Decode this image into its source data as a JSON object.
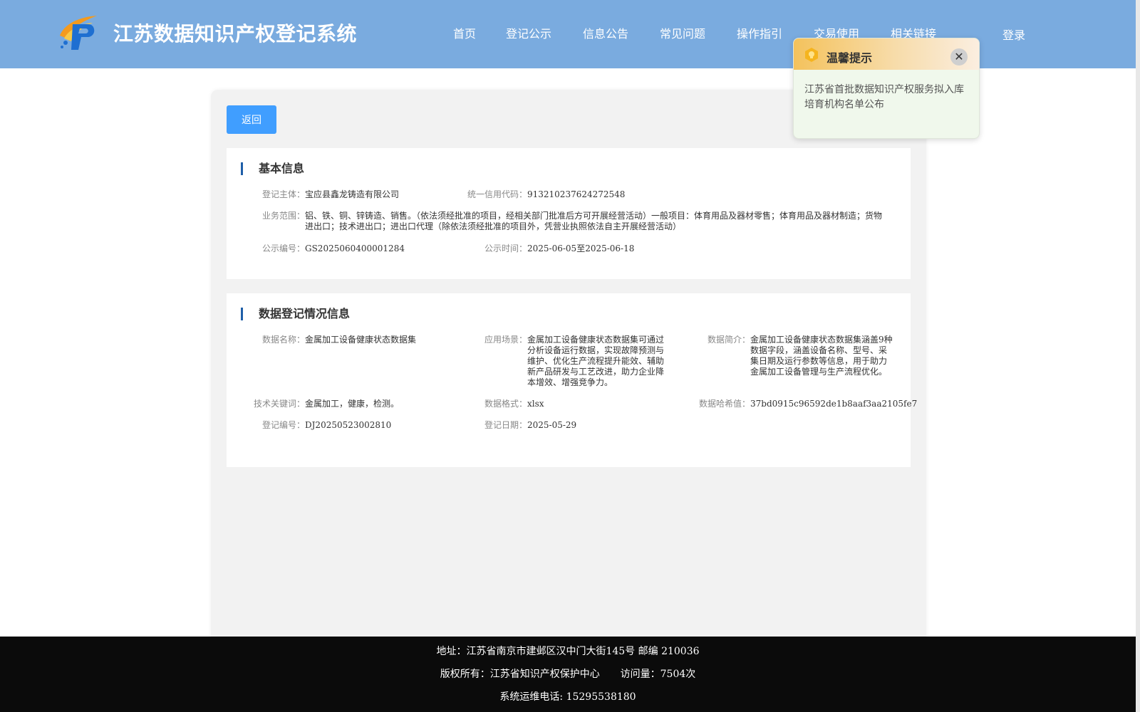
{
  "header": {
    "site_title": "江苏数据知识产权登记系统",
    "nav": [
      {
        "label": "首页"
      },
      {
        "label": "登记公示"
      },
      {
        "label": "信息公告"
      },
      {
        "label": "常见问题"
      },
      {
        "label": "操作指引"
      },
      {
        "label": "交易使用"
      },
      {
        "label": "相关链接"
      }
    ],
    "login_label": "登录"
  },
  "main": {
    "back_label": "返回",
    "basic_info": {
      "title": "基本信息",
      "subject_label": "登记主体：",
      "subject_value": "宝应县鑫龙铸造有限公司",
      "credit_code_label": "统一信用代码：",
      "credit_code_value": "913210237624272548",
      "scope_label": "业务范围：",
      "scope_value": "铝、铁、铜、锌铸造、销售。（依法须经批准的项目，经相关部门批准后方可开展经营活动）一般项目：体育用品及器材零售；体育用品及器材制造；货物进出口；技术进出口；进出口代理（除依法须经批准的项目外，凭营业执照依法自主开展经营活动）",
      "notice_no_label": "公示编号：",
      "notice_no_value": "GS2025060400001284",
      "notice_time_label": "公示时间：",
      "notice_time_value": "2025-06-05至2025-06-18"
    },
    "data_info": {
      "title": "数据登记情况信息",
      "name_label": "数据名称：",
      "name_value": "金属加工设备健康状态数据集",
      "scenario_label": "应用场景：",
      "scenario_value": "金属加工设备健康状态数据集可通过分析设备运行数据，实现故障预测与维护、优化生产流程提升能效、辅助新产品研发与工艺改进，助力企业降本增效、增强竞争力。",
      "intro_label": "数据简介：",
      "intro_value": "金属加工设备健康状态数据集涵盖9种数据字段，涵盖设备名称、型号、采集日期及运行参数等信息，用于助力金属加工设备管理与生产流程优化。",
      "keywords_label": "技术关键词：",
      "keywords_value": "金属加工，健康，检测。",
      "format_label": "数据格式：",
      "format_value": "xlsx",
      "hash_label": "数据哈希值：",
      "hash_value": "37bd0915c96592de1b8aaf3aa2105fe7",
      "reg_no_label": "登记编号：",
      "reg_no_value": "DJ20250523002810",
      "reg_date_label": "登记日期：",
      "reg_date_value": "2025-05-29"
    }
  },
  "footer": {
    "address": "地址：江苏省南京市建邺区汉中门大街145号 邮编 210036",
    "copyright": "版权所有：江苏省知识产权保护中心",
    "visits": "访问量：7504次",
    "phone": "系统运维电话: 15295538180"
  },
  "toast": {
    "title": "温馨提示",
    "close_icon": "close-icon",
    "message": "江苏省首批数据知识产权服务拟入库培育机构名单公布"
  },
  "colors": {
    "header_bg": "#7aabdf",
    "primary": "#409eff",
    "section_accent": "#1f5fa8",
    "footer_bg": "#0b0b0b"
  }
}
